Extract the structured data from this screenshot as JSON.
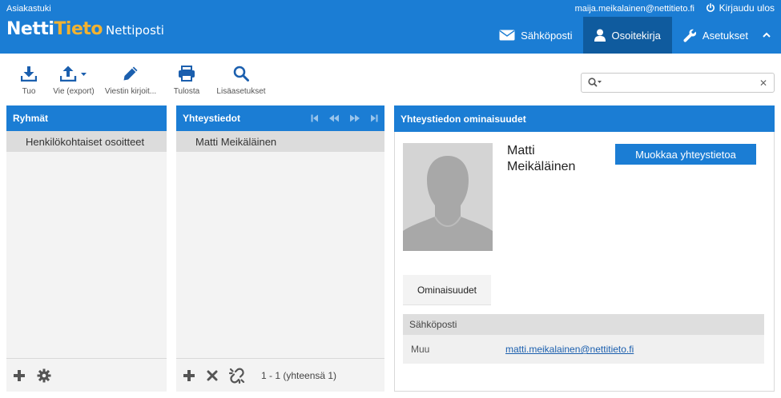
{
  "header": {
    "support_link": "Asiakastuki",
    "brand_part1": "Netti",
    "brand_part2": "Tieto",
    "product": "Nettiposti",
    "user_email": "maija.meikalainen@nettitieto.fi",
    "logout_label": "Kirjaudu ulos",
    "tasks": [
      {
        "label": "Sähköposti",
        "icon": "mail-icon"
      },
      {
        "label": "Osoitekirja",
        "icon": "user-icon",
        "selected": true
      },
      {
        "label": "Asetukset",
        "icon": "wrench-icon"
      }
    ]
  },
  "toolbar": {
    "import_label": "Tuo",
    "export_label": "Vie (export)",
    "compose_label": "Viestin kirjoit...",
    "print_label": "Tulosta",
    "advanced_label": "Lisäasetukset"
  },
  "search": {
    "placeholder": "",
    "value": ""
  },
  "groups": {
    "title": "Ryhmät",
    "items": [
      "Henkilökohtaiset osoitteet"
    ]
  },
  "contacts": {
    "title": "Yhteystiedot",
    "items": [
      "Matti Meikäläinen"
    ],
    "count_text": "1 - 1 (yhteensä 1)"
  },
  "details": {
    "title": "Yhteystiedon ominaisuudet",
    "name": "Matti Meikäläinen",
    "edit_label": "Muokkaa yhteystietoa",
    "tab_label": "Ominaisuudet",
    "section_title": "Sähköposti",
    "email_type": "Muu",
    "email_value": "matti.meikalainen@nettitieto.fi"
  },
  "colors": {
    "primary": "#1b7dd4",
    "selected_task": "#0f5b9e",
    "brand_accent": "#f2b230"
  }
}
